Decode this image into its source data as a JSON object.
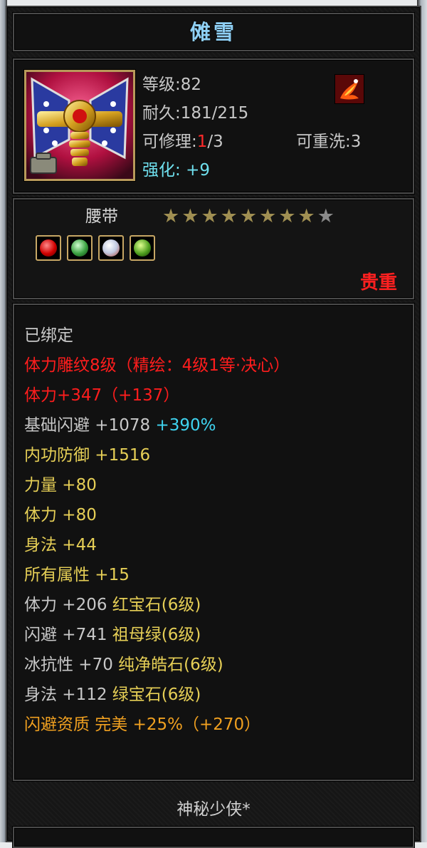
{
  "item": {
    "name": "傩雪",
    "level_label": "等级:",
    "level": "82",
    "durability_label": "耐久:",
    "durability": "181/215",
    "repair_label": "可修理:",
    "repair_count": "1",
    "repair_total": "/3",
    "rewash_label": "可重洗:",
    "rewash": "3",
    "enhance_label": "强化:",
    "enhance": "+9",
    "type": "腰带",
    "stars_filled": 8,
    "stars_total": 9,
    "rarity": "贵重",
    "maker": "神秘少侠*"
  },
  "icons": {
    "item_icon": "belt-icon",
    "badge_icon": "phoenix-badge-icon",
    "gems": [
      "red-gem-icon",
      "green-leaf-gem-icon",
      "white-gem-icon",
      "green-gem-icon"
    ]
  },
  "colors": {
    "title": "#8fd0f5",
    "cyan": "#3fd4f0",
    "red": "#ff1d1d",
    "yellow": "#e6cf56",
    "orange": "#f0a020",
    "white": "#c8c8c8"
  },
  "attributes": [
    {
      "parts": [
        {
          "text": "已绑定",
          "color": "white"
        }
      ]
    },
    {
      "parts": [
        {
          "text": "体力雕纹8级（精绘：4级1等·决心）",
          "color": "red"
        }
      ]
    },
    {
      "parts": [
        {
          "text": "体力+347（+137）",
          "color": "red"
        }
      ]
    },
    {
      "parts": [
        {
          "text": "基础闪避  +1078 ",
          "color": "white"
        },
        {
          "text": "+390%",
          "color": "cyan"
        }
      ]
    },
    {
      "parts": [
        {
          "text": "内功防御  +1516",
          "color": "yellow"
        }
      ]
    },
    {
      "parts": [
        {
          "text": "力量  +80",
          "color": "yellow"
        }
      ]
    },
    {
      "parts": [
        {
          "text": "体力  +80",
          "color": "yellow"
        }
      ]
    },
    {
      "parts": [
        {
          "text": "身法  +44",
          "color": "yellow"
        }
      ]
    },
    {
      "parts": [
        {
          "text": "所有属性  +15",
          "color": "yellow"
        }
      ]
    },
    {
      "parts": [
        {
          "text": "体力  +206  ",
          "color": "white"
        },
        {
          "text": "红宝石(6级)",
          "color": "yellow"
        }
      ]
    },
    {
      "parts": [
        {
          "text": "闪避  +741  ",
          "color": "white"
        },
        {
          "text": "祖母绿(6级)",
          "color": "yellow"
        }
      ]
    },
    {
      "parts": [
        {
          "text": "冰抗性  +70  ",
          "color": "white"
        },
        {
          "text": "纯净皓石(6级)",
          "color": "yellow"
        }
      ]
    },
    {
      "parts": [
        {
          "text": "身法  +112  ",
          "color": "white"
        },
        {
          "text": "绿宝石(6级)",
          "color": "yellow"
        }
      ]
    },
    {
      "parts": [
        {
          "text": "闪避资质   完美  +25%（+270）",
          "color": "orange"
        }
      ]
    }
  ]
}
